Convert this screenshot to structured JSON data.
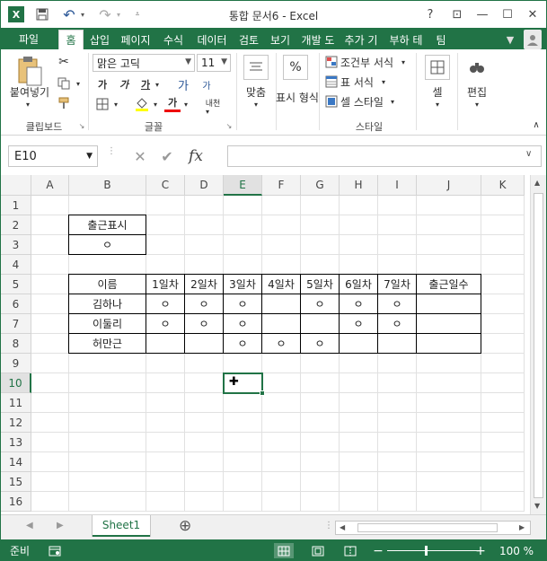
{
  "window": {
    "title": "통합 문서6 - Excel",
    "qat_undo": "↶",
    "qat_redo": "↷",
    "help": "?",
    "restore_ribbon": "⊡",
    "minimize": "—",
    "maximize": "☐",
    "close": "✕",
    "user_avatar": "🙂"
  },
  "tabs": {
    "file": "파일",
    "items": [
      "홈",
      "삽입",
      "페이지",
      "수식",
      "데이터",
      "검토",
      "보기",
      "개발 도",
      "추가 기",
      "부하 테",
      "팀"
    ],
    "active_index": 0
  },
  "ribbon": {
    "clipboard": {
      "paste_label": "붙여넣기",
      "group_label": "클립보드"
    },
    "font": {
      "font_name": "맑은 고딕",
      "font_size": "11",
      "bold": "가",
      "italic": "가",
      "underline": "가",
      "grow": "가",
      "shrink": "가",
      "font_color_glyph": "가",
      "phonetic": "내천",
      "group_label": "글꼴"
    },
    "align": {
      "label": "맞춤"
    },
    "number": {
      "label": "표시 형식",
      "symbol": "%"
    },
    "styles": {
      "conditional": "조건부 서식",
      "table": "표 서식",
      "cell_style": "셀 스타일",
      "group_label": "스타일"
    },
    "cells": {
      "label": "셀"
    },
    "editing": {
      "label": "편집"
    }
  },
  "formula_bar": {
    "name_box": "E10",
    "cancel": "✕",
    "enter": "✔",
    "fx": "fx",
    "content": ""
  },
  "grid": {
    "columns": [
      "A",
      "B",
      "C",
      "D",
      "E",
      "F",
      "G",
      "H",
      "I",
      "J",
      "K"
    ],
    "rows": [
      "1",
      "2",
      "3",
      "4",
      "5",
      "6",
      "7",
      "8",
      "9",
      "10",
      "11",
      "12",
      "13",
      "14",
      "15",
      "16"
    ],
    "selected_column": "E",
    "selected_row": "10",
    "cells": {
      "B2": "출근표시",
      "B3": "ㅇ",
      "B5": "이름",
      "C5": "1일차",
      "D5": "2일차",
      "E5": "3일차",
      "F5": "4일차",
      "G5": "5일차",
      "H5": "6일차",
      "I5": "7일차",
      "J5": "출근일수",
      "B6": "김하나",
      "C6": "ㅇ",
      "D6": "ㅇ",
      "E6": "ㅇ",
      "G6": "ㅇ",
      "H6": "ㅇ",
      "I6": "ㅇ",
      "B7": "이둘리",
      "C7": "ㅇ",
      "D7": "ㅇ",
      "E7": "ㅇ",
      "H7": "ㅇ",
      "I7": "ㅇ",
      "B8": "허만근",
      "E8": "ㅇ",
      "F8": "ㅇ",
      "G8": "ㅇ"
    }
  },
  "sheets": {
    "tabs": [
      "Sheet1"
    ],
    "add": "⊕"
  },
  "status": {
    "ready": "준비",
    "zoom_minus": "−",
    "zoom_plus": "+",
    "zoom": "100 %"
  }
}
